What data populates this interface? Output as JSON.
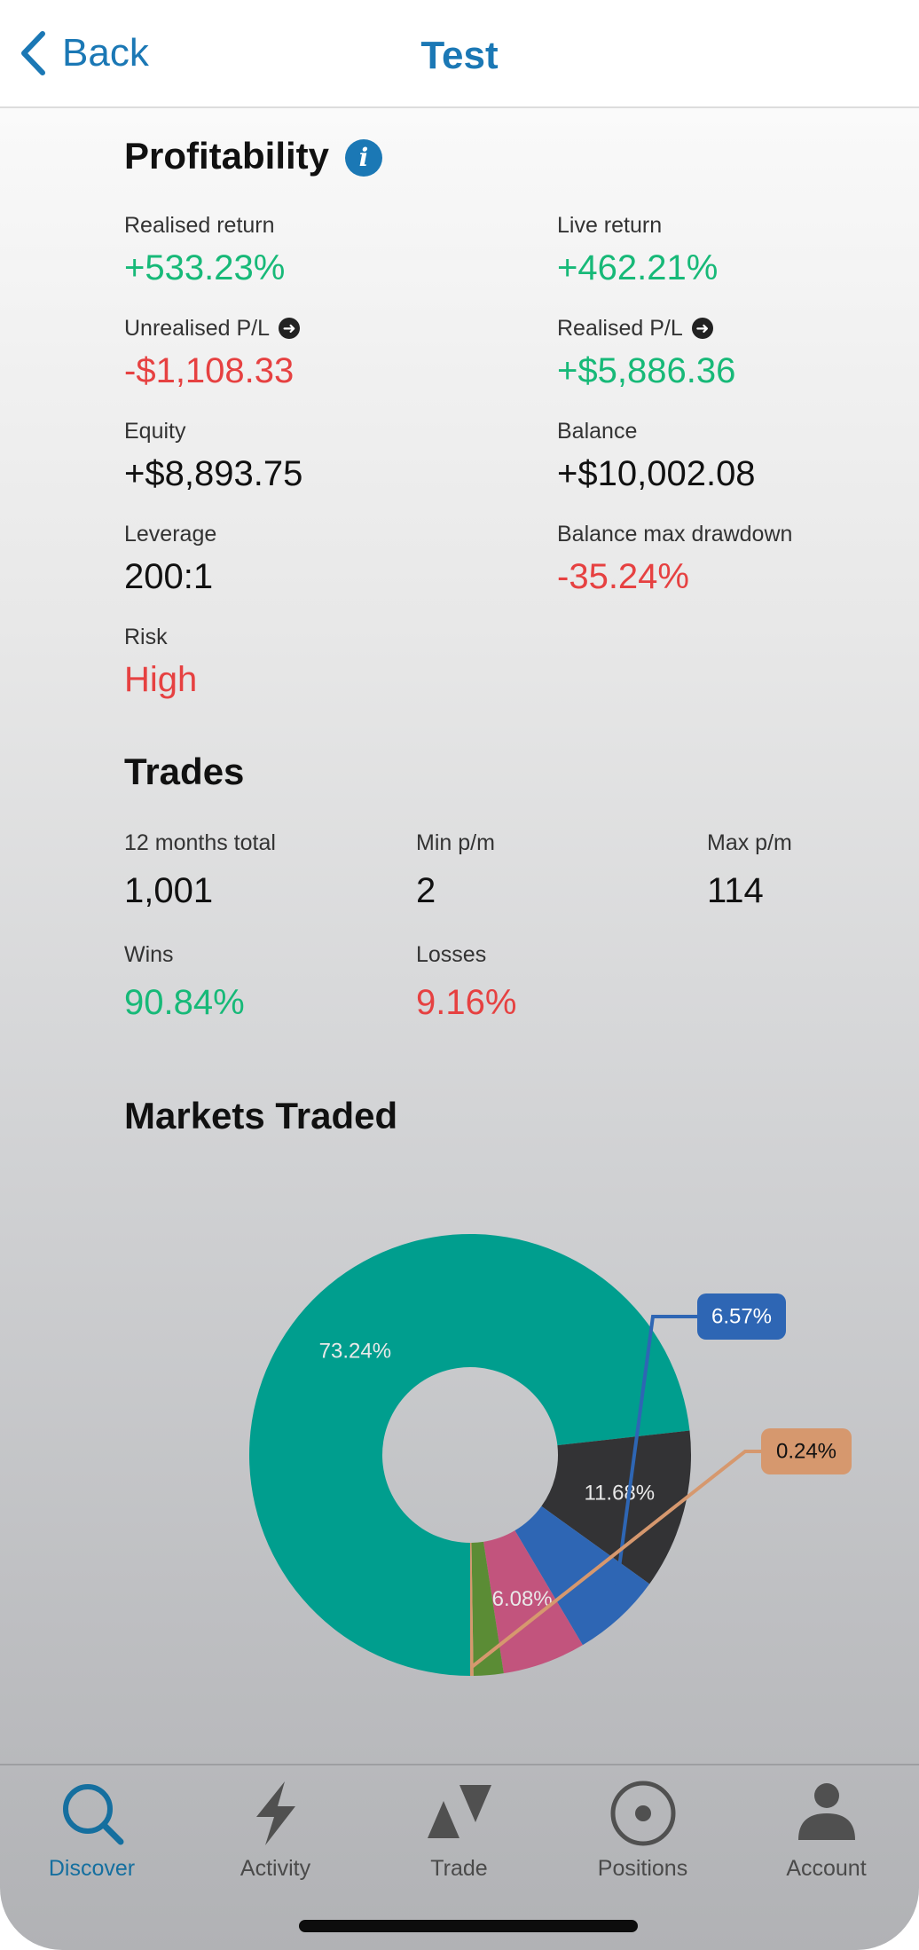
{
  "nav": {
    "back_label": "Back",
    "title": "Test"
  },
  "profitability": {
    "title": "Profitability",
    "metrics": [
      {
        "label": "Realised return",
        "value": "+533.23%",
        "tone": "green"
      },
      {
        "label": "Live return",
        "value": "+462.21%",
        "tone": "green"
      },
      {
        "label": "Unrealised P/L",
        "value": "-$1,108.33",
        "tone": "red"
      },
      {
        "label": "Realised P/L",
        "value": "+$5,886.36",
        "tone": "green"
      },
      {
        "label": "Equity",
        "value": "+$8,893.75",
        "tone": "dark"
      },
      {
        "label": "Balance",
        "value": "+$10,002.08",
        "tone": "dark"
      },
      {
        "label": "Leverage",
        "value": "200:1",
        "tone": "dark"
      },
      {
        "label": "Balance max drawdown",
        "value": "-35.24%",
        "tone": "red"
      },
      {
        "label": "Risk",
        "value": "High",
        "tone": "red"
      }
    ]
  },
  "trades": {
    "title": "Trades",
    "metrics": [
      {
        "label": "12 months total",
        "value": "1,001",
        "tone": "dark"
      },
      {
        "label": "Min p/m",
        "value": "2",
        "tone": "dark"
      },
      {
        "label": "Max p/m",
        "value": "114",
        "tone": "dark"
      },
      {
        "label": "Wins",
        "value": "90.84%",
        "tone": "green"
      },
      {
        "label": "Losses",
        "value": "9.16%",
        "tone": "red"
      }
    ]
  },
  "markets": {
    "title": "Markets Traded"
  },
  "chart_data": {
    "type": "pie",
    "donut": true,
    "slices": [
      {
        "label": "73.24%",
        "value": 73.24,
        "color": "#009e8e"
      },
      {
        "label": "11.68%",
        "value": 11.68,
        "color": "#333335"
      },
      {
        "label": "6.57%",
        "value": 6.57,
        "color": "#2e66b4"
      },
      {
        "label": "6.08%",
        "value": 6.08,
        "color": "#c2547d"
      },
      {
        "label": "",
        "value": 2.19,
        "color": "#5b8c35"
      },
      {
        "label": "0.24%",
        "value": 0.24,
        "color": "#d6986e"
      }
    ]
  },
  "colors": {
    "accent": "#1b78b5",
    "positive": "#17b978",
    "negative": "#e64141"
  },
  "tabs": [
    {
      "id": "discover",
      "label": "Discover",
      "icon": "search-icon",
      "active": true
    },
    {
      "id": "activity",
      "label": "Activity",
      "icon": "lightning-icon",
      "active": false
    },
    {
      "id": "trade",
      "label": "Trade",
      "icon": "trade-triangles-icon",
      "active": false
    },
    {
      "id": "positions",
      "label": "Positions",
      "icon": "target-icon",
      "active": false
    },
    {
      "id": "account",
      "label": "Account",
      "icon": "user-icon",
      "active": false
    }
  ]
}
